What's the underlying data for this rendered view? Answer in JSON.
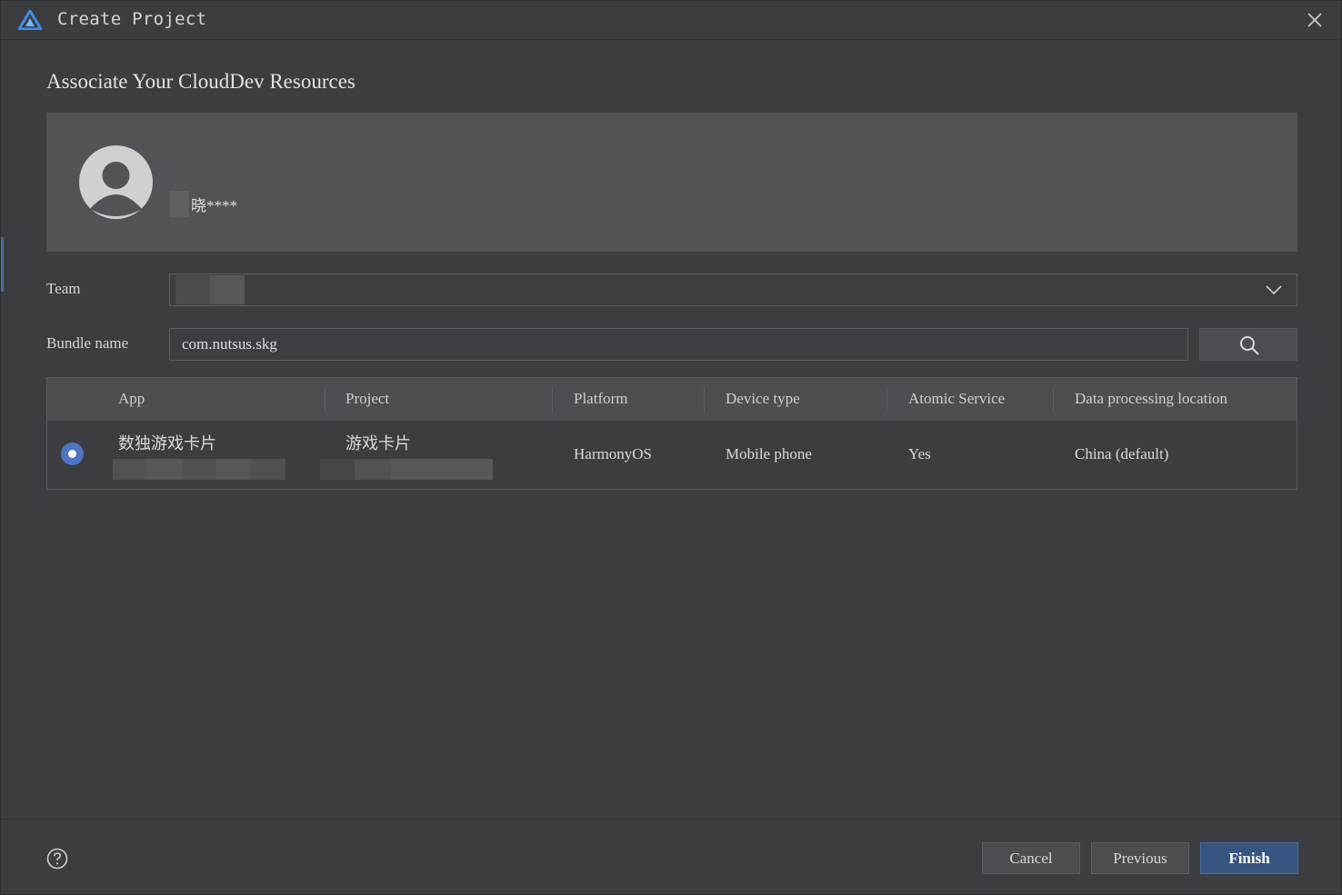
{
  "window": {
    "title": "Create Project"
  },
  "section_title": "Associate Your CloudDev Resources",
  "account": {
    "user_name": "晓****"
  },
  "team": {
    "label": "Team",
    "selected_value": ""
  },
  "bundle": {
    "label": "Bundle name",
    "value": "com.nutsus.skg"
  },
  "table": {
    "columns": [
      "App",
      "Project",
      "Platform",
      "Device type",
      "Atomic Service",
      "Data processing location"
    ],
    "rows": [
      {
        "selected": true,
        "app": "数独游戏卡片",
        "project": "游戏卡片",
        "platform": "HarmonyOS",
        "device_type": "Mobile phone",
        "atomic_service": "Yes",
        "location": "China (default)"
      }
    ]
  },
  "footer": {
    "cancel": "Cancel",
    "previous": "Previous",
    "finish": "Finish"
  },
  "colors": {
    "background": "#3b3d40",
    "panel": "#525356",
    "accent": "#4f75c6",
    "primary_button": "#365580"
  },
  "icons": [
    "harmony-logo-icon",
    "close-icon",
    "avatar-icon",
    "chevron-down-icon",
    "search-icon",
    "help-icon"
  ]
}
